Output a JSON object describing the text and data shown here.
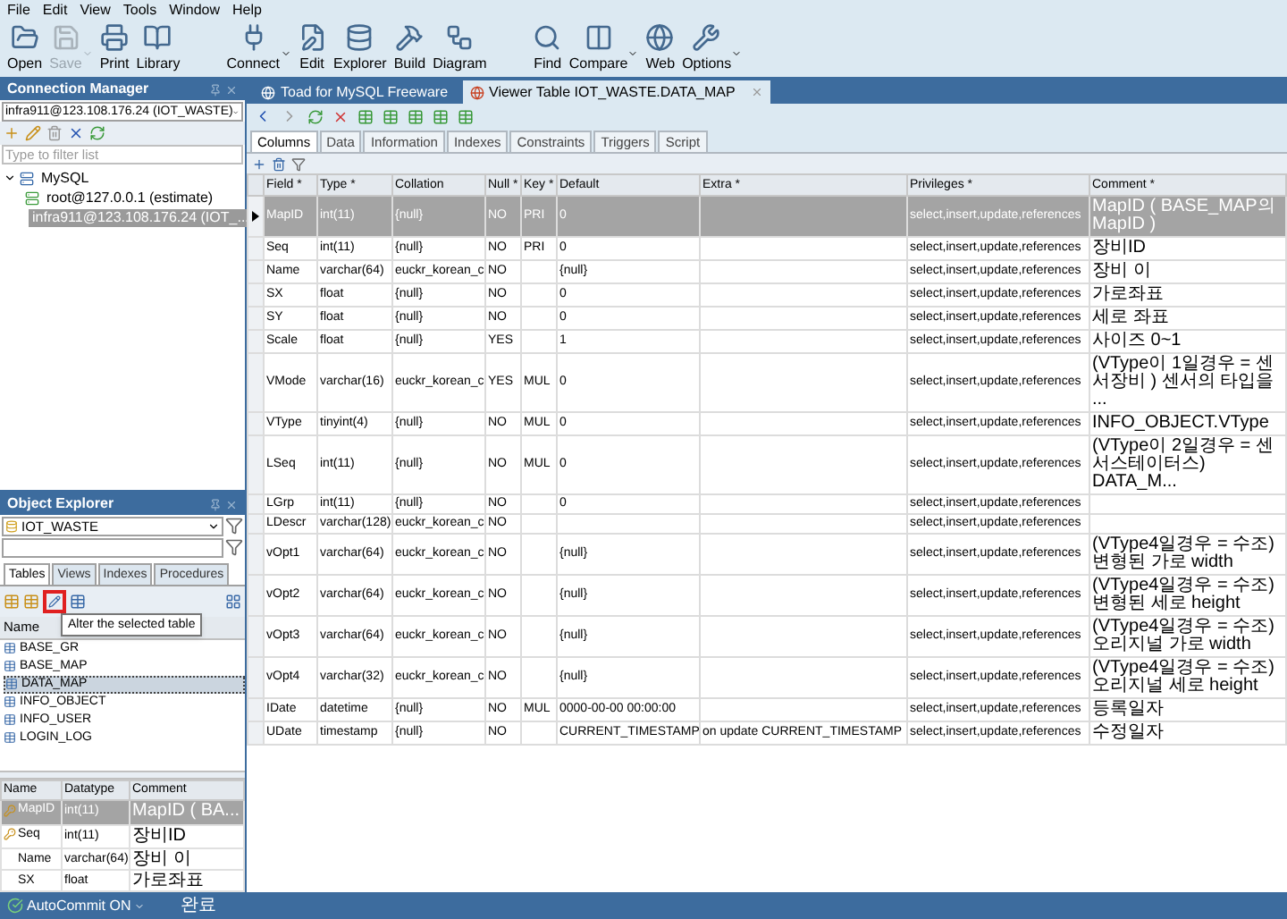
{
  "menu": [
    "File",
    "Edit",
    "View",
    "Tools",
    "Window",
    "Help"
  ],
  "toolbar": [
    [
      {
        "label": "Open",
        "disabled": false,
        "dropdown": false
      },
      {
        "label": "Save",
        "disabled": true,
        "dropdown": true
      },
      {
        "label": "Print",
        "disabled": false,
        "dropdown": false
      },
      {
        "label": "Library",
        "disabled": false,
        "dropdown": false
      }
    ],
    [
      {
        "label": "Connect",
        "disabled": false,
        "dropdown": true
      },
      {
        "label": "Edit",
        "disabled": false,
        "dropdown": false
      },
      {
        "label": "Explorer",
        "disabled": false,
        "dropdown": false
      },
      {
        "label": "Build",
        "disabled": false,
        "dropdown": false
      },
      {
        "label": "Diagram",
        "disabled": false,
        "dropdown": false
      }
    ],
    [
      {
        "label": "Find",
        "disabled": false,
        "dropdown": false
      },
      {
        "label": "Compare",
        "disabled": false,
        "dropdown": true
      },
      {
        "label": "Web",
        "disabled": false,
        "dropdown": false
      },
      {
        "label": "Options",
        "disabled": false,
        "dropdown": true
      }
    ]
  ],
  "connection_manager": {
    "title": "Connection Manager",
    "connection": "infra911@123.108.176.24 (IOT_WASTE)",
    "filter_placeholder": "Type to filter list",
    "tree": [
      {
        "label": "MySQL",
        "expanded": true,
        "children": [
          {
            "label": "root@127.0.0.1 (estimate)",
            "selected": false
          },
          {
            "label": "infra911@123.108.176.24 (IOT_...",
            "selected": true
          }
        ]
      }
    ]
  },
  "object_explorer": {
    "title": "Object Explorer",
    "database": "IOT_WASTE",
    "tabs": [
      {
        "label": "Tables",
        "selected": true
      },
      {
        "label": "Views",
        "selected": false
      },
      {
        "label": "Indexes",
        "selected": false
      },
      {
        "label": "Procedures",
        "selected": false
      }
    ],
    "tooltip": "Alter the selected table",
    "list_header": "Name",
    "tables": [
      {
        "name": "BASE_GR",
        "selected": false
      },
      {
        "name": "BASE_MAP",
        "selected": false
      },
      {
        "name": "DATA_MAP",
        "selected": true
      },
      {
        "name": "INFO_OBJECT",
        "selected": false
      },
      {
        "name": "INFO_USER",
        "selected": false
      },
      {
        "name": "LOGIN_LOG",
        "selected": false
      }
    ],
    "grid": {
      "columns": [
        "Name",
        "Datatype",
        "Comment"
      ],
      "rows": [
        {
          "name": "MapID",
          "datatype": "int(11)",
          "comment": "MapID ( BA...",
          "key": true,
          "selected": true
        },
        {
          "name": "Seq",
          "datatype": "int(11)",
          "comment": "장비ID",
          "key": true,
          "selected": false
        },
        {
          "name": "Name",
          "datatype": "varchar(64)",
          "comment": "장비 이",
          "key": false,
          "selected": false
        },
        {
          "name": "SX",
          "datatype": "float",
          "comment": "가로좌표",
          "key": false,
          "selected": false
        }
      ]
    }
  },
  "document_tabs": [
    {
      "label": "Toad for MySQL Freeware",
      "selected": false
    },
    {
      "label": "Viewer Table IOT_WASTE.DATA_MAP",
      "selected": true
    }
  ],
  "subtabs": [
    {
      "label": "Columns",
      "selected": true
    },
    {
      "label": "Data",
      "selected": false
    },
    {
      "label": "Information",
      "selected": false
    },
    {
      "label": "Indexes",
      "selected": false
    },
    {
      "label": "Constraints",
      "selected": false
    },
    {
      "label": "Triggers",
      "selected": false
    },
    {
      "label": "Script",
      "selected": false
    }
  ],
  "table": {
    "columns": [
      "Field *",
      "Type *",
      "Collation",
      "Null *",
      "Key *",
      "Default",
      "Extra *",
      "Privileges *",
      "Comment *"
    ],
    "rows": [
      {
        "field": "MapID",
        "type": "int(11)",
        "collation": "{null}",
        "null": "NO",
        "key": "PRI",
        "default": "0",
        "privileges": "select,insert,update,references",
        "comment": "MapID ( BASE_MAP의 MapID )",
        "selected": true
      },
      {
        "field": "Seq",
        "type": "int(11)",
        "collation": "{null}",
        "null": "NO",
        "key": "PRI",
        "default": "0",
        "privileges": "select,insert,update,references",
        "comment": "장비ID",
        "selected": false
      },
      {
        "field": "Name",
        "type": "varchar(64)",
        "collation": "euckr_korean_c",
        "null": "NO",
        "default": "{null}",
        "privileges": "select,insert,update,references",
        "comment": "장비 이",
        "selected": false
      },
      {
        "field": "SX",
        "type": "float",
        "collation": "{null}",
        "null": "NO",
        "default": "0",
        "privileges": "select,insert,update,references",
        "comment": "가로좌표",
        "selected": false
      },
      {
        "field": "SY",
        "type": "float",
        "collation": "{null}",
        "null": "NO",
        "default": "0",
        "privileges": "select,insert,update,references",
        "comment": "세로 좌표",
        "selected": false
      },
      {
        "field": "Scale",
        "type": "float",
        "collation": "{null}",
        "null": "YES",
        "default": "1",
        "privileges": "select,insert,update,references",
        "comment": "사이즈 0~1",
        "selected": false
      },
      {
        "field": "VMode",
        "type": "varchar(16)",
        "collation": "euckr_korean_c",
        "null": "YES",
        "key": "MUL",
        "default": "0",
        "privileges": "select,insert,update,references",
        "comment": "(VType이 1일경우 = 센서장비 ) 센서의 타입을 ...",
        "selected": false
      },
      {
        "field": "VType",
        "type": "tinyint(4)",
        "collation": "{null}",
        "null": "NO",
        "key": "MUL",
        "default": "0",
        "privileges": "select,insert,update,references",
        "comment": "INFO_OBJECT.VType",
        "selected": false
      },
      {
        "field": "LSeq",
        "type": "int(11)",
        "collation": "{null}",
        "null": "NO",
        "key": "MUL",
        "default": "0",
        "privileges": "select,insert,update,references",
        "comment": "(VType이 2일경우 = 센서스테이터스) DATA_M...",
        "selected": false
      },
      {
        "field": "LGrp",
        "type": "int(11)",
        "collation": "{null}",
        "null": "NO",
        "default": "0",
        "privileges": "select,insert,update,references",
        "selected": false
      },
      {
        "field": "LDescr",
        "type": "varchar(128)",
        "collation": "euckr_korean_c",
        "null": "NO",
        "privileges": "select,insert,update,references",
        "selected": false
      },
      {
        "field": "vOpt1",
        "type": "varchar(64)",
        "collation": "euckr_korean_c",
        "null": "NO",
        "default": "{null}",
        "privileges": "select,insert,update,references",
        "comment": "(VType4일경우 = 수조) 변형된 가로 width",
        "selected": false
      },
      {
        "field": "vOpt2",
        "type": "varchar(64)",
        "collation": "euckr_korean_c",
        "null": "NO",
        "default": "{null}",
        "privileges": "select,insert,update,references",
        "comment": "(VType4일경우 = 수조) 변형된 세로 height",
        "selected": false
      },
      {
        "field": "vOpt3",
        "type": "varchar(64)",
        "collation": "euckr_korean_c",
        "null": "NO",
        "default": "{null}",
        "privileges": "select,insert,update,references",
        "comment": "(VType4일경우 = 수조) 오리지널 가로 width",
        "selected": false
      },
      {
        "field": "vOpt4",
        "type": "varchar(32)",
        "collation": "euckr_korean_c",
        "null": "NO",
        "default": "{null}",
        "privileges": "select,insert,update,references",
        "comment": "(VType4일경우 = 수조) 오리지널 세로 height",
        "selected": false
      },
      {
        "field": "IDate",
        "type": "datetime",
        "collation": "{null}",
        "null": "NO",
        "key": "MUL",
        "default": "0000-00-00 00:00:00",
        "privileges": "select,insert,update,references",
        "comment": "등록일자",
        "selected": false
      },
      {
        "field": "UDate",
        "type": "timestamp",
        "collation": "{null}",
        "null": "NO",
        "default": "CURRENT_TIMESTAMP",
        "extra": "on update CURRENT_TIMESTAMP",
        "privileges": "select,insert,update,references",
        "comment": "수정일자",
        "selected": false
      }
    ]
  },
  "status_bar": {
    "autocommit": "AutoCommit ON",
    "message": "완료"
  }
}
